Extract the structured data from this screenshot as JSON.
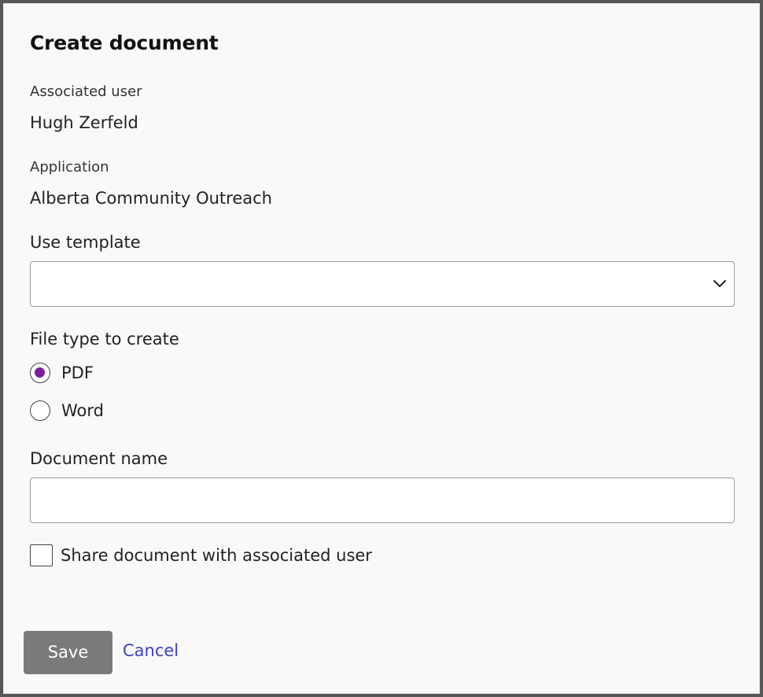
{
  "dialog": {
    "title": "Create document"
  },
  "associated_user": {
    "label": "Associated user",
    "value": "Hugh Zerfeld"
  },
  "application": {
    "label": "Application",
    "value": "Alberta Community Outreach"
  },
  "template": {
    "label": "Use template",
    "selected": ""
  },
  "file_type": {
    "label": "File type to create",
    "options": [
      {
        "label": "PDF",
        "checked": true
      },
      {
        "label": "Word",
        "checked": false
      }
    ]
  },
  "document_name": {
    "label": "Document name",
    "value": ""
  },
  "share": {
    "label": "Share document with associated user",
    "checked": false
  },
  "actions": {
    "save_label": "Save",
    "cancel_label": "Cancel"
  },
  "colors": {
    "radio_accent": "#7a1ea0",
    "save_button_bg": "#7a7a7a",
    "cancel_link": "#3b42c9"
  }
}
